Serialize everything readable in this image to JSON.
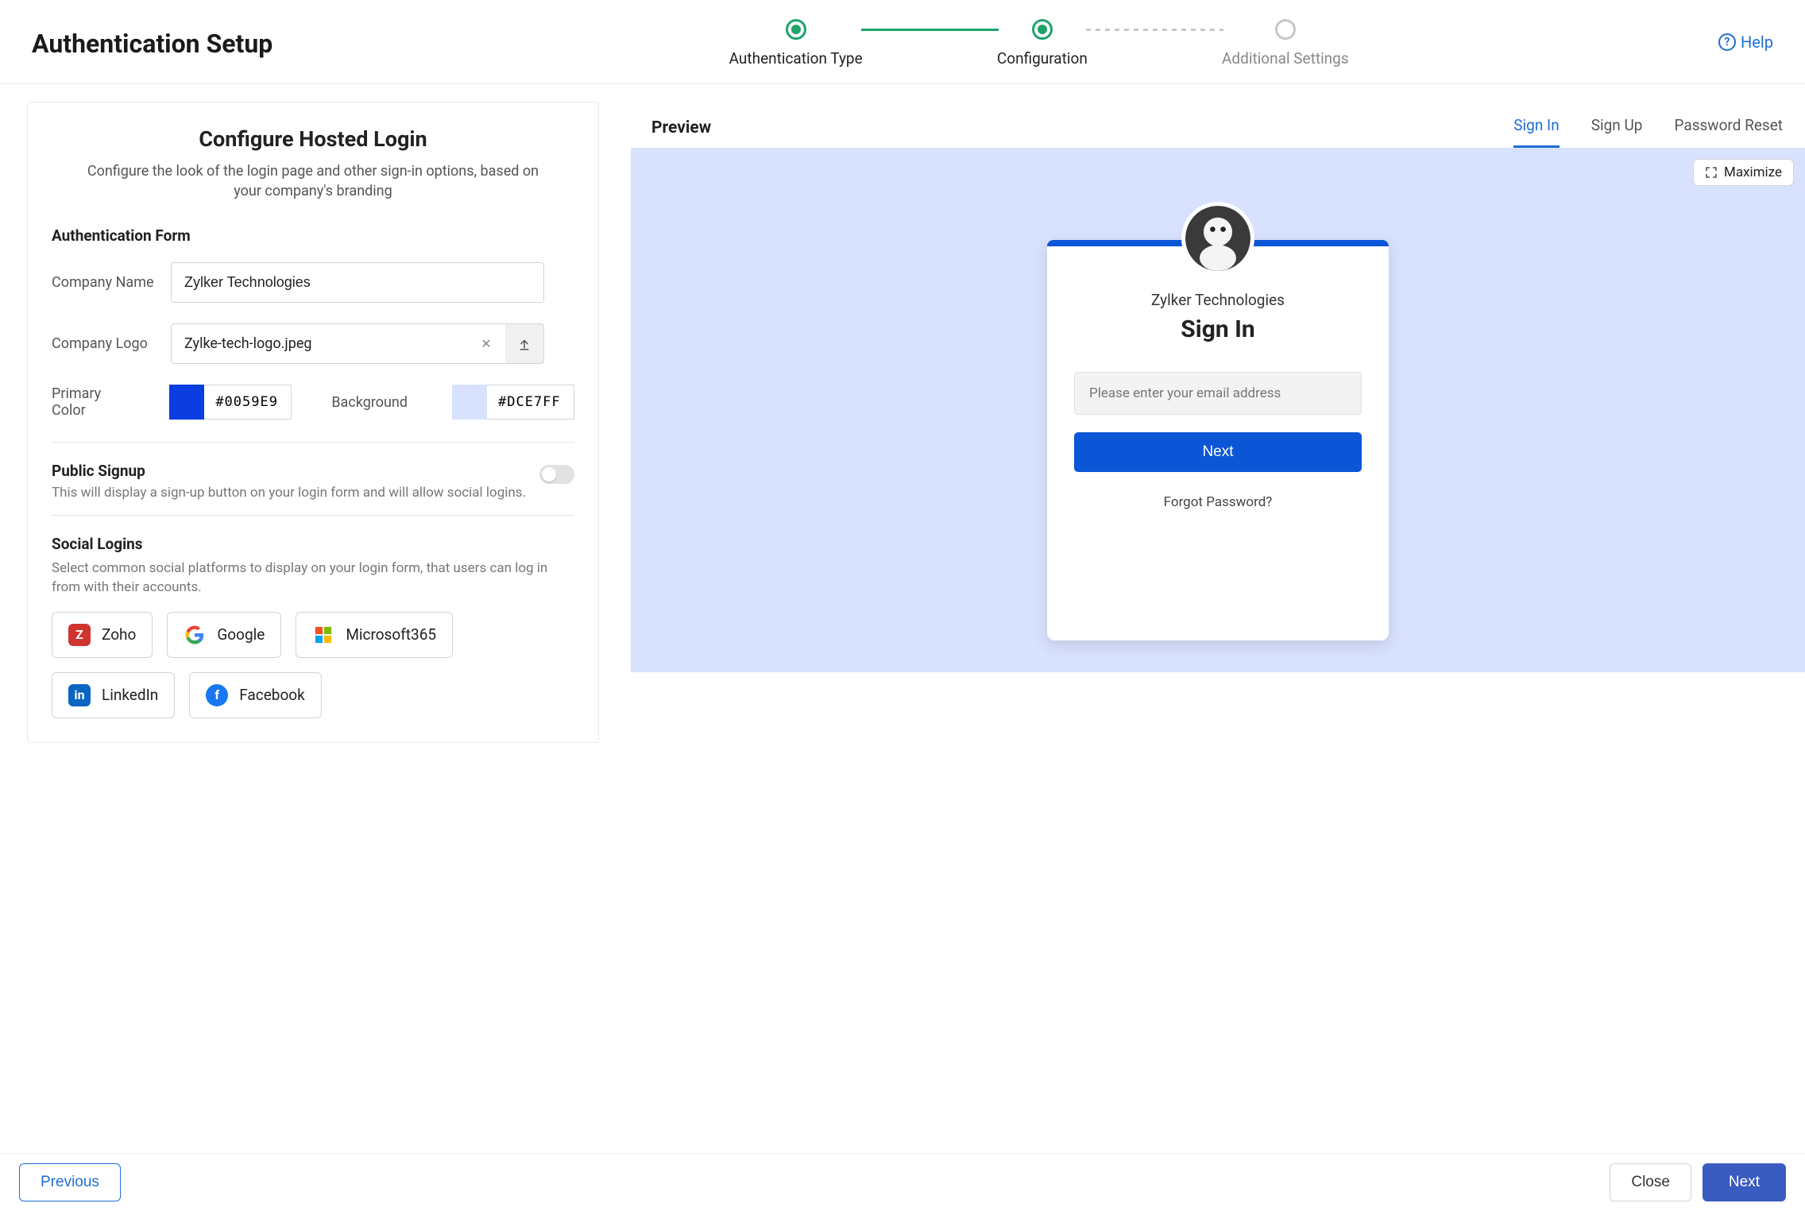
{
  "header": {
    "title": "Authentication Setup",
    "help": "Help",
    "steps": [
      "Authentication Type",
      "Configuration",
      "Additional Settings"
    ]
  },
  "panel": {
    "title": "Configure Hosted Login",
    "subtitle": "Configure the look of the login page and other sign-in options, based on your company's branding"
  },
  "form": {
    "section_heading": "Authentication Form",
    "company_name": {
      "label": "Company Name",
      "value": "Zylker Technologies"
    },
    "company_logo": {
      "label": "Company Logo",
      "filename": "Zylke-tech-logo.jpeg"
    },
    "primary_color": {
      "label": "Primary Color",
      "hex": "#0059E9"
    },
    "background": {
      "label": "Background",
      "hex": "#DCE7FF"
    }
  },
  "public_signup": {
    "title": "Public Signup",
    "desc": "This will display a sign-up button on your login form and will allow social logins.",
    "enabled": false
  },
  "social": {
    "title": "Social Logins",
    "desc": "Select common social platforms to display on your login form, that users can log in from with their accounts.",
    "providers": [
      {
        "name": "Zoho"
      },
      {
        "name": "Google"
      },
      {
        "name": "Microsoft365"
      },
      {
        "name": "LinkedIn"
      },
      {
        "name": "Facebook"
      }
    ]
  },
  "preview": {
    "label": "Preview",
    "tabs": [
      "Sign In",
      "Sign Up",
      "Password Reset"
    ],
    "maximize": "Maximize",
    "company": "Zylker Technologies",
    "heading": "Sign In",
    "email_placeholder": "Please enter your email address",
    "next": "Next",
    "forgot": "Forgot Password?"
  },
  "footer": {
    "previous": "Previous",
    "close": "Close",
    "next": "Next"
  }
}
